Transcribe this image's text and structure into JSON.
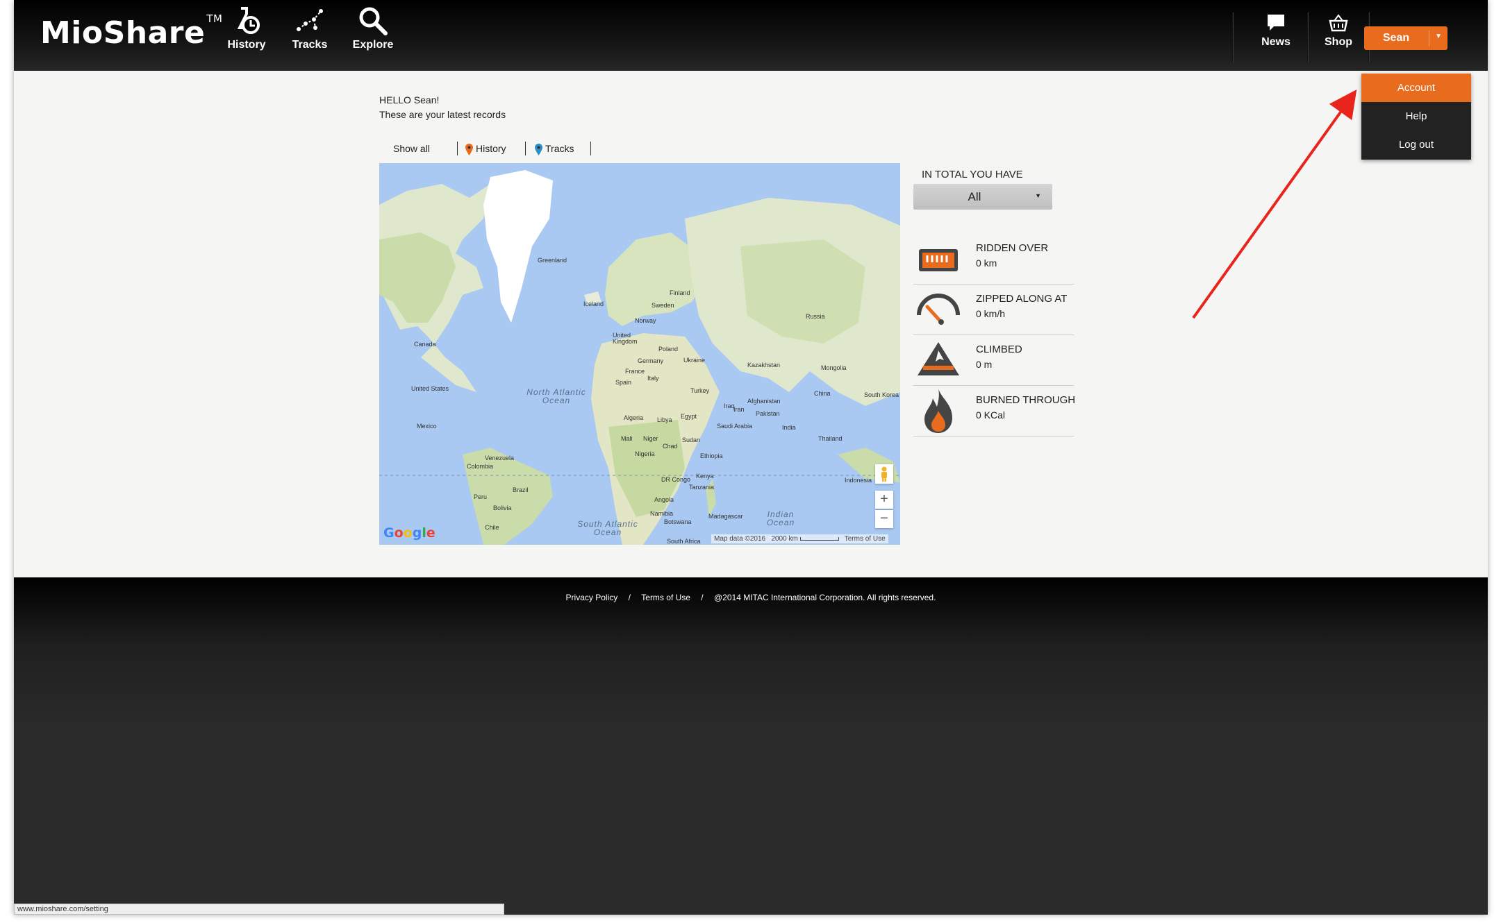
{
  "header": {
    "logo": "MioShare",
    "logo_tm": "TM",
    "nav": [
      {
        "label": "History",
        "icon": "history-icon"
      },
      {
        "label": "Tracks",
        "icon": "tracks-icon"
      },
      {
        "label": "Explore",
        "icon": "search-icon"
      }
    ],
    "right_nav": [
      {
        "label": "News",
        "icon": "chat-icon"
      },
      {
        "label": "Shop",
        "icon": "basket-icon"
      }
    ],
    "user_button": "Sean"
  },
  "user_menu": {
    "items": [
      "Account",
      "Help",
      "Log out"
    ],
    "active": "Account"
  },
  "greeting": {
    "line1": "HELLO Sean!",
    "line2": "These are your latest records"
  },
  "filters": [
    "Show all",
    "History",
    "Tracks"
  ],
  "map": {
    "labels": [
      "Greenland",
      "Iceland",
      "Finland",
      "Sweden",
      "Norway",
      "Russia",
      "United Kingdom",
      "Poland",
      "Ukraine",
      "Germany",
      "France",
      "Spain",
      "Italy",
      "Kazakhstan",
      "Mongolia",
      "Turkey",
      "Afghanistan",
      "Iraq",
      "Iran",
      "Pakistan",
      "China",
      "South Korea",
      "India",
      "Thailand",
      "Indonesia",
      "Canada",
      "United States",
      "Mexico",
      "Venezuela",
      "Colombia",
      "Peru",
      "Brazil",
      "Bolivia",
      "Chile",
      "Algeria",
      "Libya",
      "Egypt",
      "Saudi Arabia",
      "Mali",
      "Niger",
      "Chad",
      "Sudan",
      "Ethiopia",
      "Nigeria",
      "Kenya",
      "DR Congo",
      "Tanzania",
      "Angola",
      "Namibia",
      "Botswana",
      "Madagascar",
      "South Africa"
    ],
    "oceans": [
      "North Atlantic Ocean",
      "South Atlantic Ocean",
      "Indian Ocean"
    ],
    "attribution": "Google",
    "map_data": "Map data ©2016",
    "scale": "2000 km",
    "terms": "Terms of Use",
    "zoom_in": "+",
    "zoom_out": "−"
  },
  "stats": {
    "title": "IN TOTAL YOU HAVE",
    "period": "All",
    "items": [
      {
        "title": "RIDDEN OVER",
        "value": "0 km",
        "icon": "odometer-icon"
      },
      {
        "title": "ZIPPED ALONG AT",
        "value": "0 km/h",
        "icon": "speedometer-icon"
      },
      {
        "title": "CLIMBED",
        "value": "0 m",
        "icon": "mountain-icon"
      },
      {
        "title": "BURNED THROUGH",
        "value": "0 KCal",
        "icon": "flame-icon"
      }
    ]
  },
  "footer": {
    "privacy": "Privacy Policy",
    "sep": "/",
    "terms": "Terms of Use",
    "copyright": "@2014 MITAC International Corporation. All rights reserved."
  },
  "status_url": "www.mioshare.com/setting",
  "colors": {
    "accent": "#e96b1e",
    "header_bg": "#000000",
    "content_bg": "#f5f5f3",
    "menu_bg": "#222222",
    "arrow": "#e8241c"
  }
}
